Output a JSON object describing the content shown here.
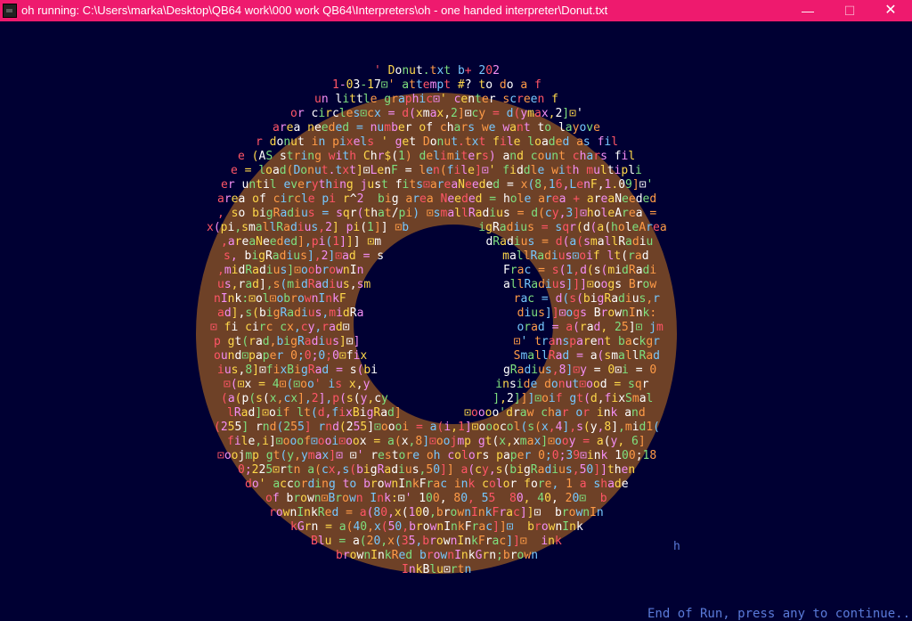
{
  "window": {
    "title": "oh running: C:\\Users\\marka\\Desktop\\QB64 work\\000 work QB64\\Interpreters\\oh - one handed interpreter\\Donut.txt",
    "minimize_glyph": "—",
    "maximize_glyph": "☐",
    "close_glyph": "✕",
    "titlebar_color": "#ee1a6e"
  },
  "output": {
    "background_color": "#000033",
    "donut_color": "#6e4127",
    "hole_color": "#000033",
    "lines": [
      "' Donut.txt b+ 202",
      "1-03-17⊡' attempt #? to do a f",
      "un little graphic⊡' center screen f",
      "or circles⊡cx = d(xmax,2]⊡cy = d(ymax,2]⊡'",
      "area needed = number of chars we want to layove",
      "r donut in pixels ' get Donut.txt file loaded as fil",
      "e (AS string with Chr$(1) delimiters) and count chars fil",
      "e = load(Donut.txt]⊡LenF = len(file]⊡' fiddle with multipli",
      "er until everything just fits⊡areaNeeded = x(8,16,LenF,1.09]⊡'",
      "area of circle pi r^2  big area Needed = hole area + areaNeeded",
      ", so bigRadius = sqr(that/pi) ⊡smallRadius = d(cy,3]⊡holeArea =",
      "x(pi,smallRadius,2] pi(1]] ⊡b          igRadius = sqr(d(a(holeArea",
      ",areaNeeded],pi(1]]] ⊡m               dRadius = d(a(smallRadiu",
      "s, bigRadius],2]⊡ad = s                 mallRadius⊡oif lt(rad",
      ",midRadius]⊡oobrownIn                    Frac = s(1,d(s(midRadi",
      "us,rad],s(midRadius,sm                   allRadius]]]⊡oogs Brow",
      "nInk:⊡ol⊡obrownInkF                        rac = d(s(bigRadius,r",
      "ad],s(bigRadius,midRa                      dius]]⊡ogs BrownInk:",
      "⊡ fi circ cx,cy,rad⊡                        orad = a(rad, 25]⊡ jm",
      "p gt(rad,bigRadius]⊡]                      ⊡' transparent backgr",
      "ound⊡paper 0;0;0;0⊡fix                     SmallRad = a(smallRad",
      "ius,8]⊡fixBigRad = s(bi                  gRadius,8]⊡y = 0⊡i = 0",
      "⊡(⊡x = 4⊡(⊡oo' is x,y                  inside donut⊡ood = sqr",
      "(a(p(s(x,cx],2],p(s(y,cy               ],2]]]⊡oif gt(d,fixSmal",
      "lRad]⊡oif lt(d,fixBigRad]         ⊡oooo'draw char or ink and",
      "(255] rnd(255] rnd(255]⊡oooi = a(i,1]⊡ooocol(s(x,4],s(y,8],mid1(",
      "file,i]⊡ooof⊡ooi⊡oox = a(x,8]⊡oojmp gt(x,xmax]⊡ooy = a(y, 6]",
      "⊡oojmp gt(y,ymax]⊡ ⊡' restore oh colors paper 0;0;39⊡ink 100;18",
      "0;225⊡rtn a(cx,s(bigRadius,50]] a(cy,s(bigRadius,50]]then",
      "do' according to brownInkFrac ink color fore, 1 a shade",
      "of brown⊡Brown Ink:⊡' 100, 80, 55  80, 40, 20⊡  b",
      "rownInkRed = a(80,x(100,brownInkFrac]]⊡  brownIn",
      "kGrn = a(40,x(50,brownInkFrac]]⊡  brownInk",
      "Blu = a(20,x(35,brownInkFrac]]⊡  ink",
      "brownInkRed brownInkGrn;brown",
      "InkBlu⊡rtn"
    ],
    "stray_char": "h",
    "end_message": "End of Run, press any to continue..."
  }
}
